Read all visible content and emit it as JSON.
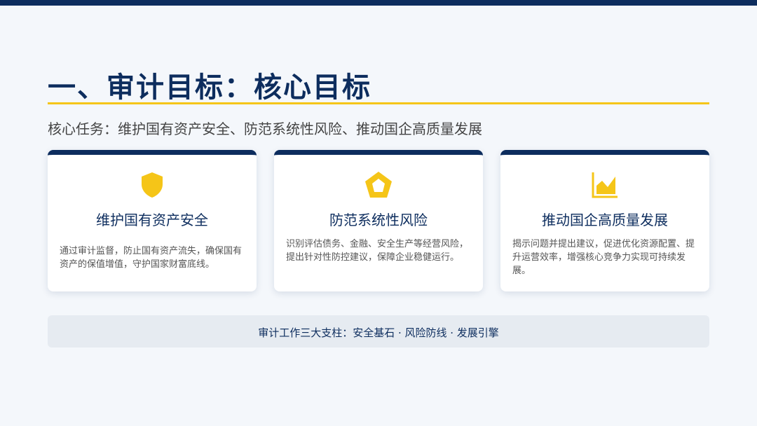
{
  "page": {
    "title": "一、审计目标：核心目标",
    "subtitle": "核心任务：维护国有资产安全、防范系统性风险、推动国企高质量发展"
  },
  "cards": [
    {
      "icon": "shield-icon",
      "title": "维护国有资产安全",
      "description": "通过审计监督，防止国有资产流失，确保国有资产的保值增值，守护国家财富底线。"
    },
    {
      "icon": "pentagon-warning-icon",
      "title": "防范系统性风险",
      "description": "识别评估债务、金融、安全生产等经营风险，提出针对性防控建议，保障企业稳健运行。"
    },
    {
      "icon": "area-chart-icon",
      "title": "推动国企高质量发展",
      "description": "揭示问题并提出建议，促进优化资源配置、提升运营效率，增强核心竞争力实现可持续发展。"
    }
  ],
  "footer": {
    "text": "审计工作三大支柱：安全基石 · 风险防线 · 发展引擎"
  },
  "colors": {
    "primary": "#0d2d5e",
    "accent": "#f5c518",
    "background": "#f4f7fb",
    "footer_background": "#e6ebf1"
  }
}
